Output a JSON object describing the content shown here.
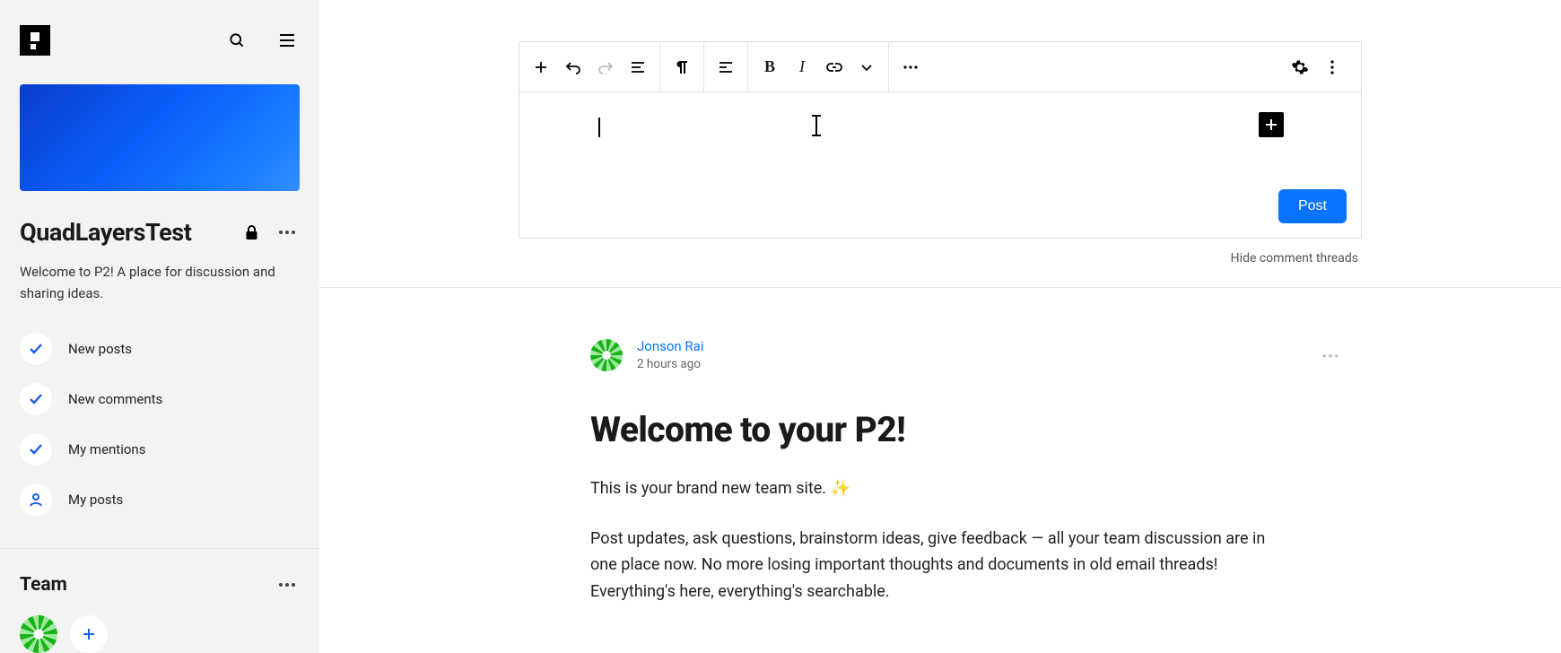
{
  "sidebar": {
    "site_title": "QuadLayersTest",
    "site_description": "Welcome to P2! A place for discussion and sharing ideas.",
    "filters": [
      {
        "label": "New posts",
        "icon": "check"
      },
      {
        "label": "New comments",
        "icon": "check"
      },
      {
        "label": "My mentions",
        "icon": "check"
      },
      {
        "label": "My posts",
        "icon": "person"
      }
    ],
    "team_heading": "Team"
  },
  "editor": {
    "post_button": "Post",
    "hide_threads": "Hide comment threads"
  },
  "post": {
    "author": "Jonson Rai",
    "timestamp": "2 hours ago",
    "title": "Welcome to your P2!",
    "para1": "This is your brand new team site. ✨",
    "para2": "Post updates, ask questions, brainstorm ideas, give feedback — all your team discussion are in one place now. No more losing important thoughts and documents in old email threads! Everything's here, everything's searchable."
  }
}
